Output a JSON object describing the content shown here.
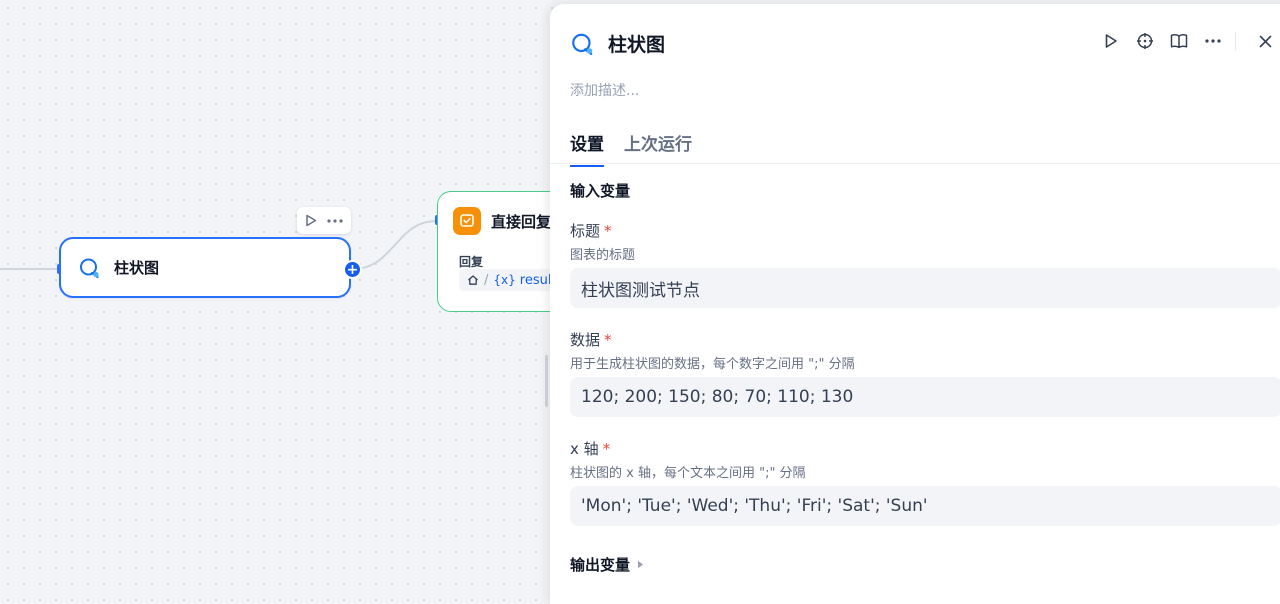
{
  "canvas": {
    "chart_node": {
      "title": "柱状图",
      "icon": "bar-chart-node-icon",
      "accent": "#2970ff"
    },
    "reply_node": {
      "title": "直接回复",
      "label": "回复",
      "variable": {
        "prefix": "{x}",
        "name": "result"
      },
      "accent": "#47cd89",
      "icon_bg": "#f79009"
    }
  },
  "panel": {
    "title": "柱状图",
    "description_placeholder": "添加描述...",
    "tabs": [
      {
        "label": "设置",
        "active": true
      },
      {
        "label": "上次运行",
        "active": false
      }
    ],
    "input_section": "输入变量",
    "fields": [
      {
        "label": "标题",
        "required": "*",
        "description": "图表的标题",
        "value": "柱状图测试节点"
      },
      {
        "label": "数据",
        "required": "*",
        "description": "用于生成柱状图的数据，每个数字之间用 \";\" 分隔",
        "value": "120; 200; 150; 80; 70; 110; 130"
      },
      {
        "label": "x 轴",
        "required": "*",
        "description": "柱状图的 x 轴，每个文本之间用 \";\" 分隔",
        "value": "'Mon'; 'Tue'; 'Wed'; 'Thu'; 'Fri'; 'Sat'; 'Sun'"
      }
    ],
    "output_section": "输出变量"
  },
  "colors": {
    "primary": "#155eef",
    "required": "#f04438",
    "reply_border": "#47cd89"
  }
}
